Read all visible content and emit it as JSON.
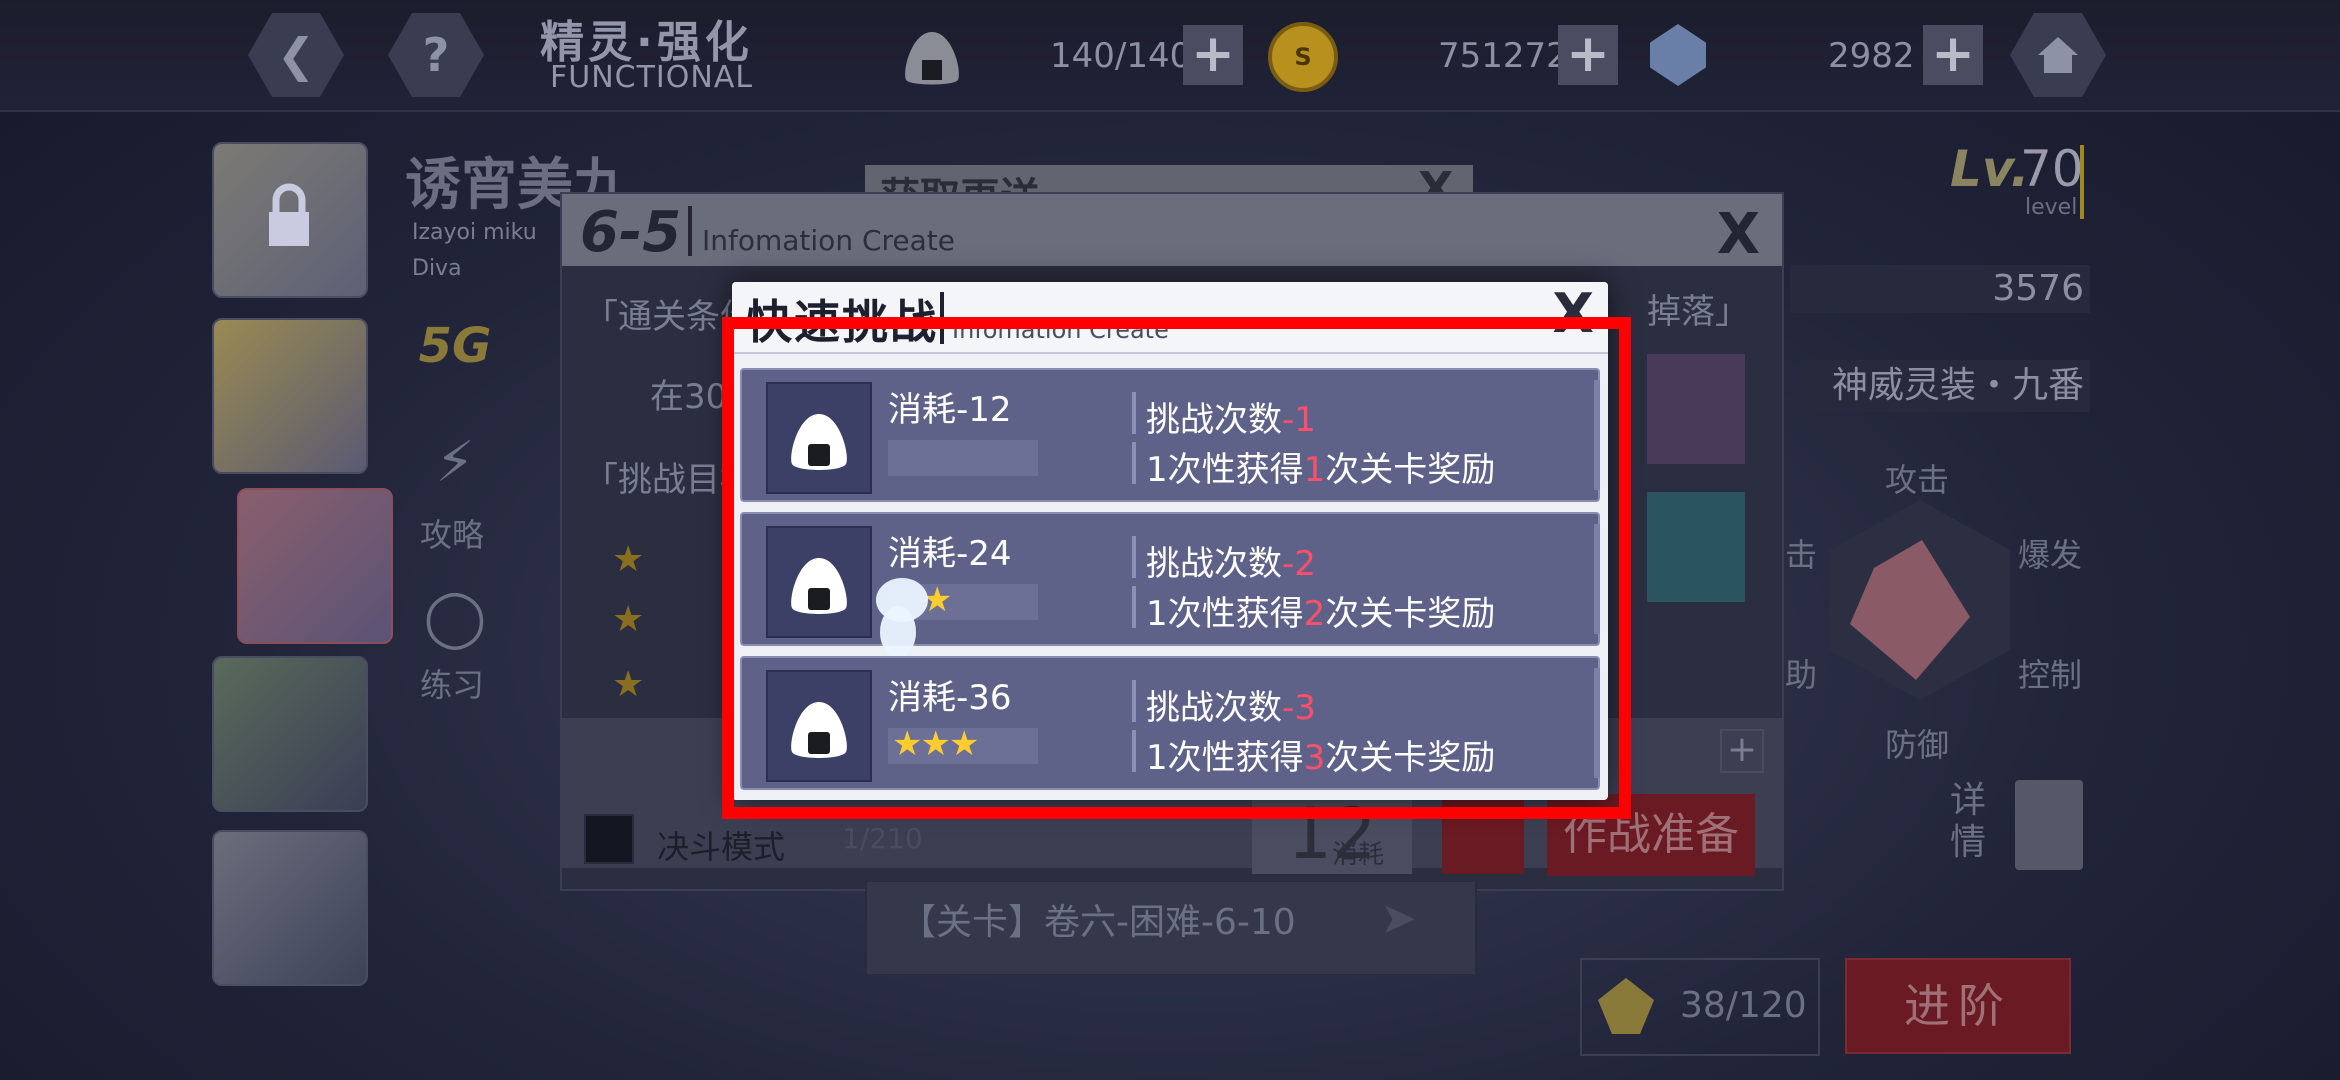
{
  "topbar": {
    "back_icon": "chevron-left-icon",
    "help_icon": "question-icon",
    "title": "精灵·强化",
    "subtitle": "FUNCTIONAL",
    "stamina": "140/140",
    "gold": "751272",
    "gems": "2982",
    "home_icon": "home-icon",
    "coin_glyph": "S"
  },
  "character": {
    "name": "诱宵美九",
    "romaji": "Izayoi miku",
    "type": "Diva",
    "rank": "5G",
    "strategy_label": "攻略",
    "practice_label": "练习"
  },
  "right_panel": {
    "lv_prefix": "Lv.",
    "lv": "70",
    "lv_sub": "level",
    "power": "3576",
    "equipment": "神威灵装・九番",
    "radar": {
      "attack": "攻击",
      "burst": "爆发",
      "control": "控制",
      "defense": "防御",
      "assist": "助",
      "strike": "击"
    },
    "details": "详\n情",
    "material_count": "38/120",
    "advance_label": "进阶"
  },
  "get_bar": {
    "title": "获取再送",
    "close": "X"
  },
  "stage_dialog": {
    "stage": "6-5",
    "subtitle": "Infomation Create",
    "close": "X",
    "clear_condition": "「通关条件",
    "condition_text": "在30",
    "challenge_target": "「挑战目标",
    "drop_label": "掉落」",
    "duel_mode": "决斗模式",
    "duel_count": "1/210",
    "consume_value": "12",
    "consume_label": "消耗",
    "prepare_label": "作战准备",
    "plus": "+"
  },
  "level_bar": {
    "text": "【关卡】卷六-困难-6-10"
  },
  "quick_challenge": {
    "title": "快速挑战",
    "subtitle": "Infomation Create",
    "close": "X",
    "rows": [
      {
        "cost": "消耗-12",
        "stars": "",
        "line1_prefix": "挑战次数",
        "line1_value": "-1",
        "line2_prefix": "1次性获得",
        "line2_value": "1",
        "line2_suffix": "次关卡奖励"
      },
      {
        "cost": "消耗-24",
        "stars": "★",
        "line1_prefix": "挑战次数",
        "line1_value": "-2",
        "line2_prefix": "1次性获得",
        "line2_value": "2",
        "line2_suffix": "次关卡奖励"
      },
      {
        "cost": "消耗-36",
        "stars": "★★★",
        "line1_prefix": "挑战次数",
        "line1_value": "-3",
        "line2_prefix": "1次性获得",
        "line2_value": "3",
        "line2_suffix": "次关卡奖励"
      }
    ]
  },
  "colors": {
    "highlight": "#ff0000",
    "accent_red": "#ff4f6a",
    "row_bg": "#5f6288"
  }
}
